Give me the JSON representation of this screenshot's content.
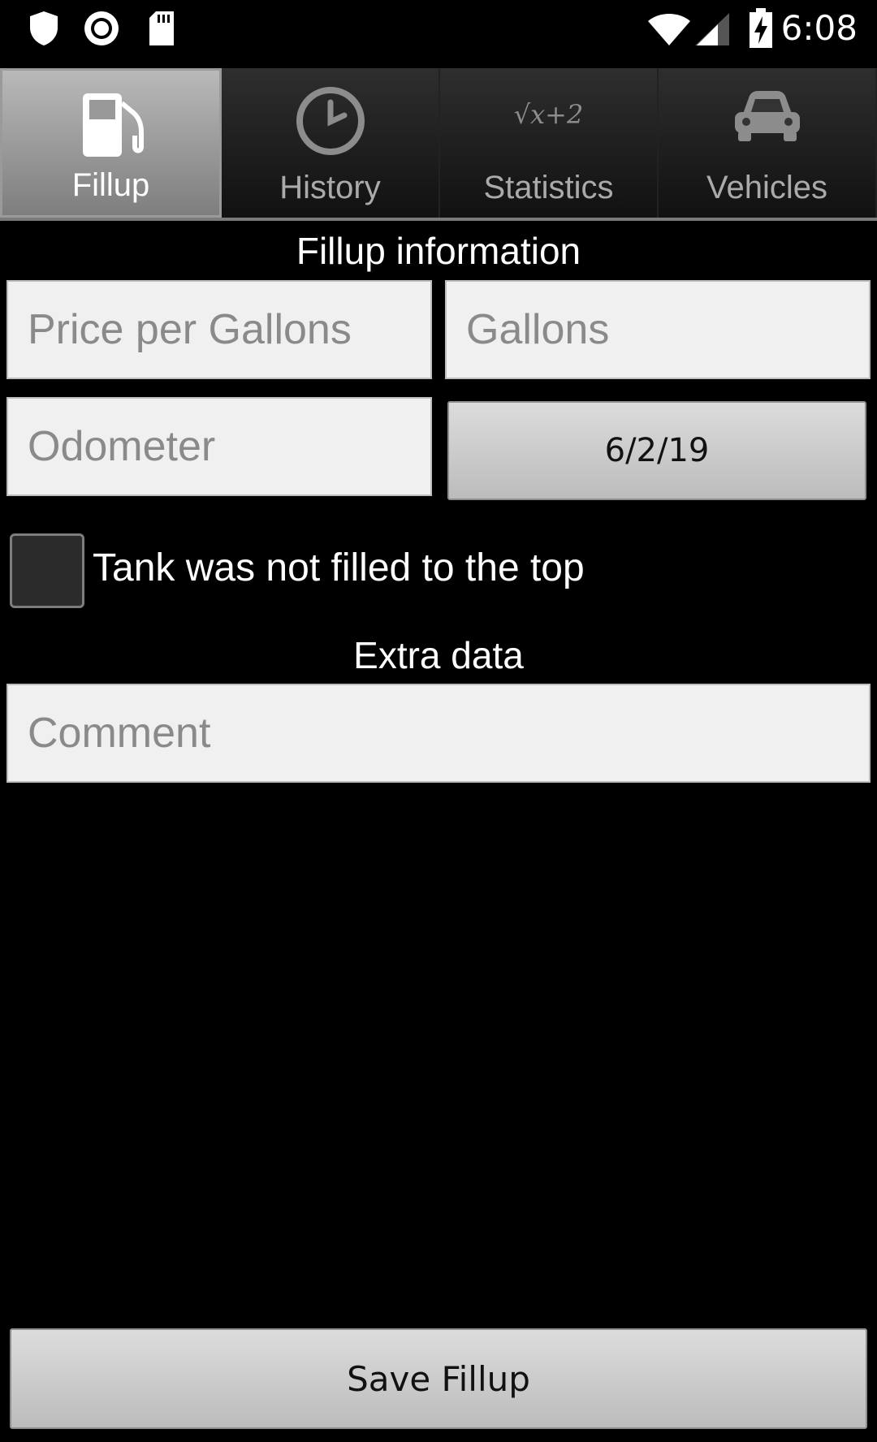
{
  "status_bar": {
    "time": "6:08",
    "icons": [
      "shield-icon",
      "record-icon",
      "sdcard-icon",
      "wifi-icon",
      "signal-icon",
      "battery-charging-icon"
    ]
  },
  "tabs": [
    {
      "label": "Fillup",
      "icon": "fuel-pump-icon",
      "active": true
    },
    {
      "label": "History",
      "icon": "clock-icon",
      "active": false
    },
    {
      "label": "Statistics",
      "icon": "sqrt-formula-icon",
      "active": false
    },
    {
      "label": "Vehicles",
      "icon": "car-icon",
      "active": false
    }
  ],
  "statistics_icon_text": "√x+2",
  "fillup_section": {
    "heading": "Fillup information",
    "price_placeholder": "Price per Gallons",
    "gallons_placeholder": "Gallons",
    "odometer_placeholder": "Odometer",
    "date_value": "6/2/19"
  },
  "tank_checkbox": {
    "label": "Tank was not filled to the top",
    "checked": false
  },
  "extra_section": {
    "heading": "Extra data",
    "comment_placeholder": "Comment"
  },
  "save_button": {
    "label": "Save Fillup"
  }
}
